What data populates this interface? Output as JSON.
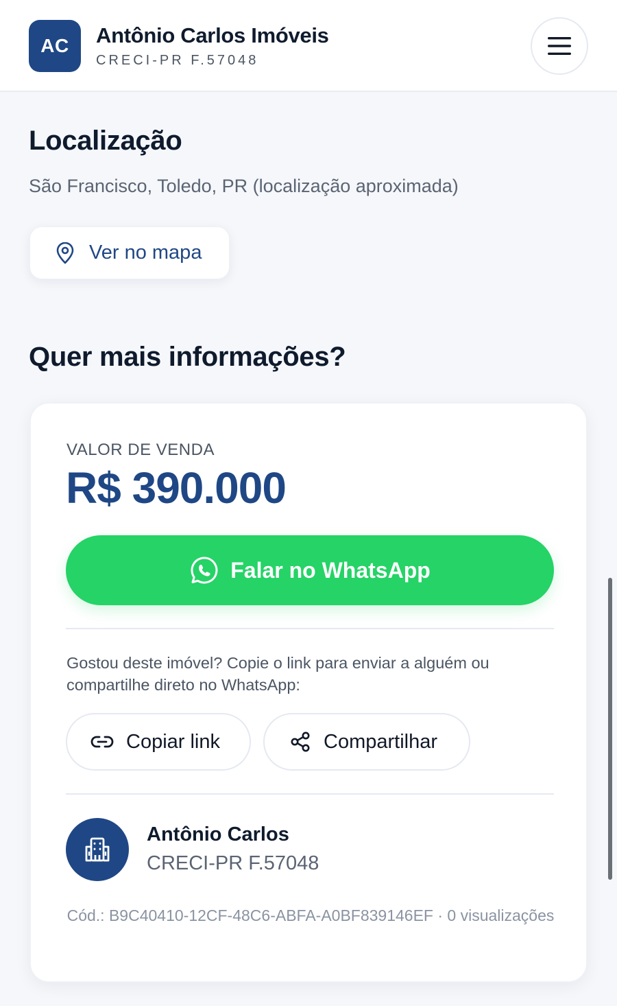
{
  "header": {
    "logo_initials": "AC",
    "brand_name": "Antônio Carlos Imóveis",
    "brand_sub": "CRECI-PR F.57048",
    "menu_icon": "hamburger-menu-icon"
  },
  "location": {
    "title": "Localização",
    "text": "São Francisco, Toledo, PR (localização aproximada)",
    "map_button_label": "Ver no mapa",
    "map_button_icon": "map-pin-icon"
  },
  "info": {
    "title": "Quer mais informações?"
  },
  "card": {
    "price_label": "VALOR DE VENDA",
    "price_value": "R$ 390.000",
    "whatsapp_label": "Falar no WhatsApp",
    "share_text": "Gostou deste imóvel? Copie o link para enviar a alguém ou compartilhe direto no WhatsApp:",
    "copy_link_label": "Copiar link",
    "share_label": "Compartilhar",
    "agent_name": "Antônio Carlos",
    "agent_creci": "CRECI-PR F.57048",
    "footer_code": "Cód.: B9C40410-12CF-48C6-ABFA-A0BF839146EF · 0 visualizações"
  },
  "colors": {
    "brand": "#1f4785",
    "whatsapp": "#25d366",
    "background": "#f5f7fb"
  }
}
